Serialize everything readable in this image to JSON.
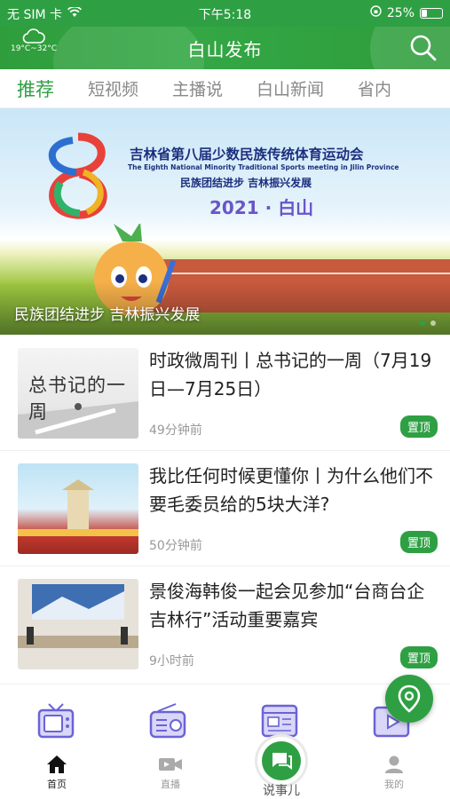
{
  "status_bar": {
    "carrier": "无 SIM 卡",
    "time": "下午5:18",
    "battery": "25%"
  },
  "header": {
    "title": "白山发布",
    "weather": "19°C~32°C"
  },
  "tabs": [
    {
      "label": "推荐"
    },
    {
      "label": "短视频"
    },
    {
      "label": "主播说"
    },
    {
      "label": "白山新闻"
    },
    {
      "label": "省内"
    }
  ],
  "banner": {
    "caption": "民族团结进步 吉林振兴发展",
    "heading": "吉林省第八届少数民族传统体育运动会",
    "heading_en": "The Eighth National Minority Traditional Sports meeting in Jilin Province",
    "slogan": "民族团结进步   吉林振兴发展",
    "year_place": "2021 · 白山",
    "thumb_text": "总书记的一周"
  },
  "news": [
    {
      "title": "时政微周刊丨总书记的一周（7月19日—7月25日）",
      "time": "49分钟前",
      "badge": "置顶"
    },
    {
      "title": "我比任何时候更懂你丨为什么他们不要毛委员给的5块大洋?",
      "time": "50分钟前",
      "badge": "置顶"
    },
    {
      "title": "景俊海韩俊一起会见参加“台商台企吉林行”活动重要嘉宾",
      "time": "9小时前",
      "badge": "置顶"
    }
  ],
  "tab_bar": {
    "home": "首页",
    "live": "直播",
    "talk": "说事儿",
    "mine": "我的"
  },
  "colors": {
    "brand": "#2ea043",
    "accent_icon": "#6b63d6"
  }
}
